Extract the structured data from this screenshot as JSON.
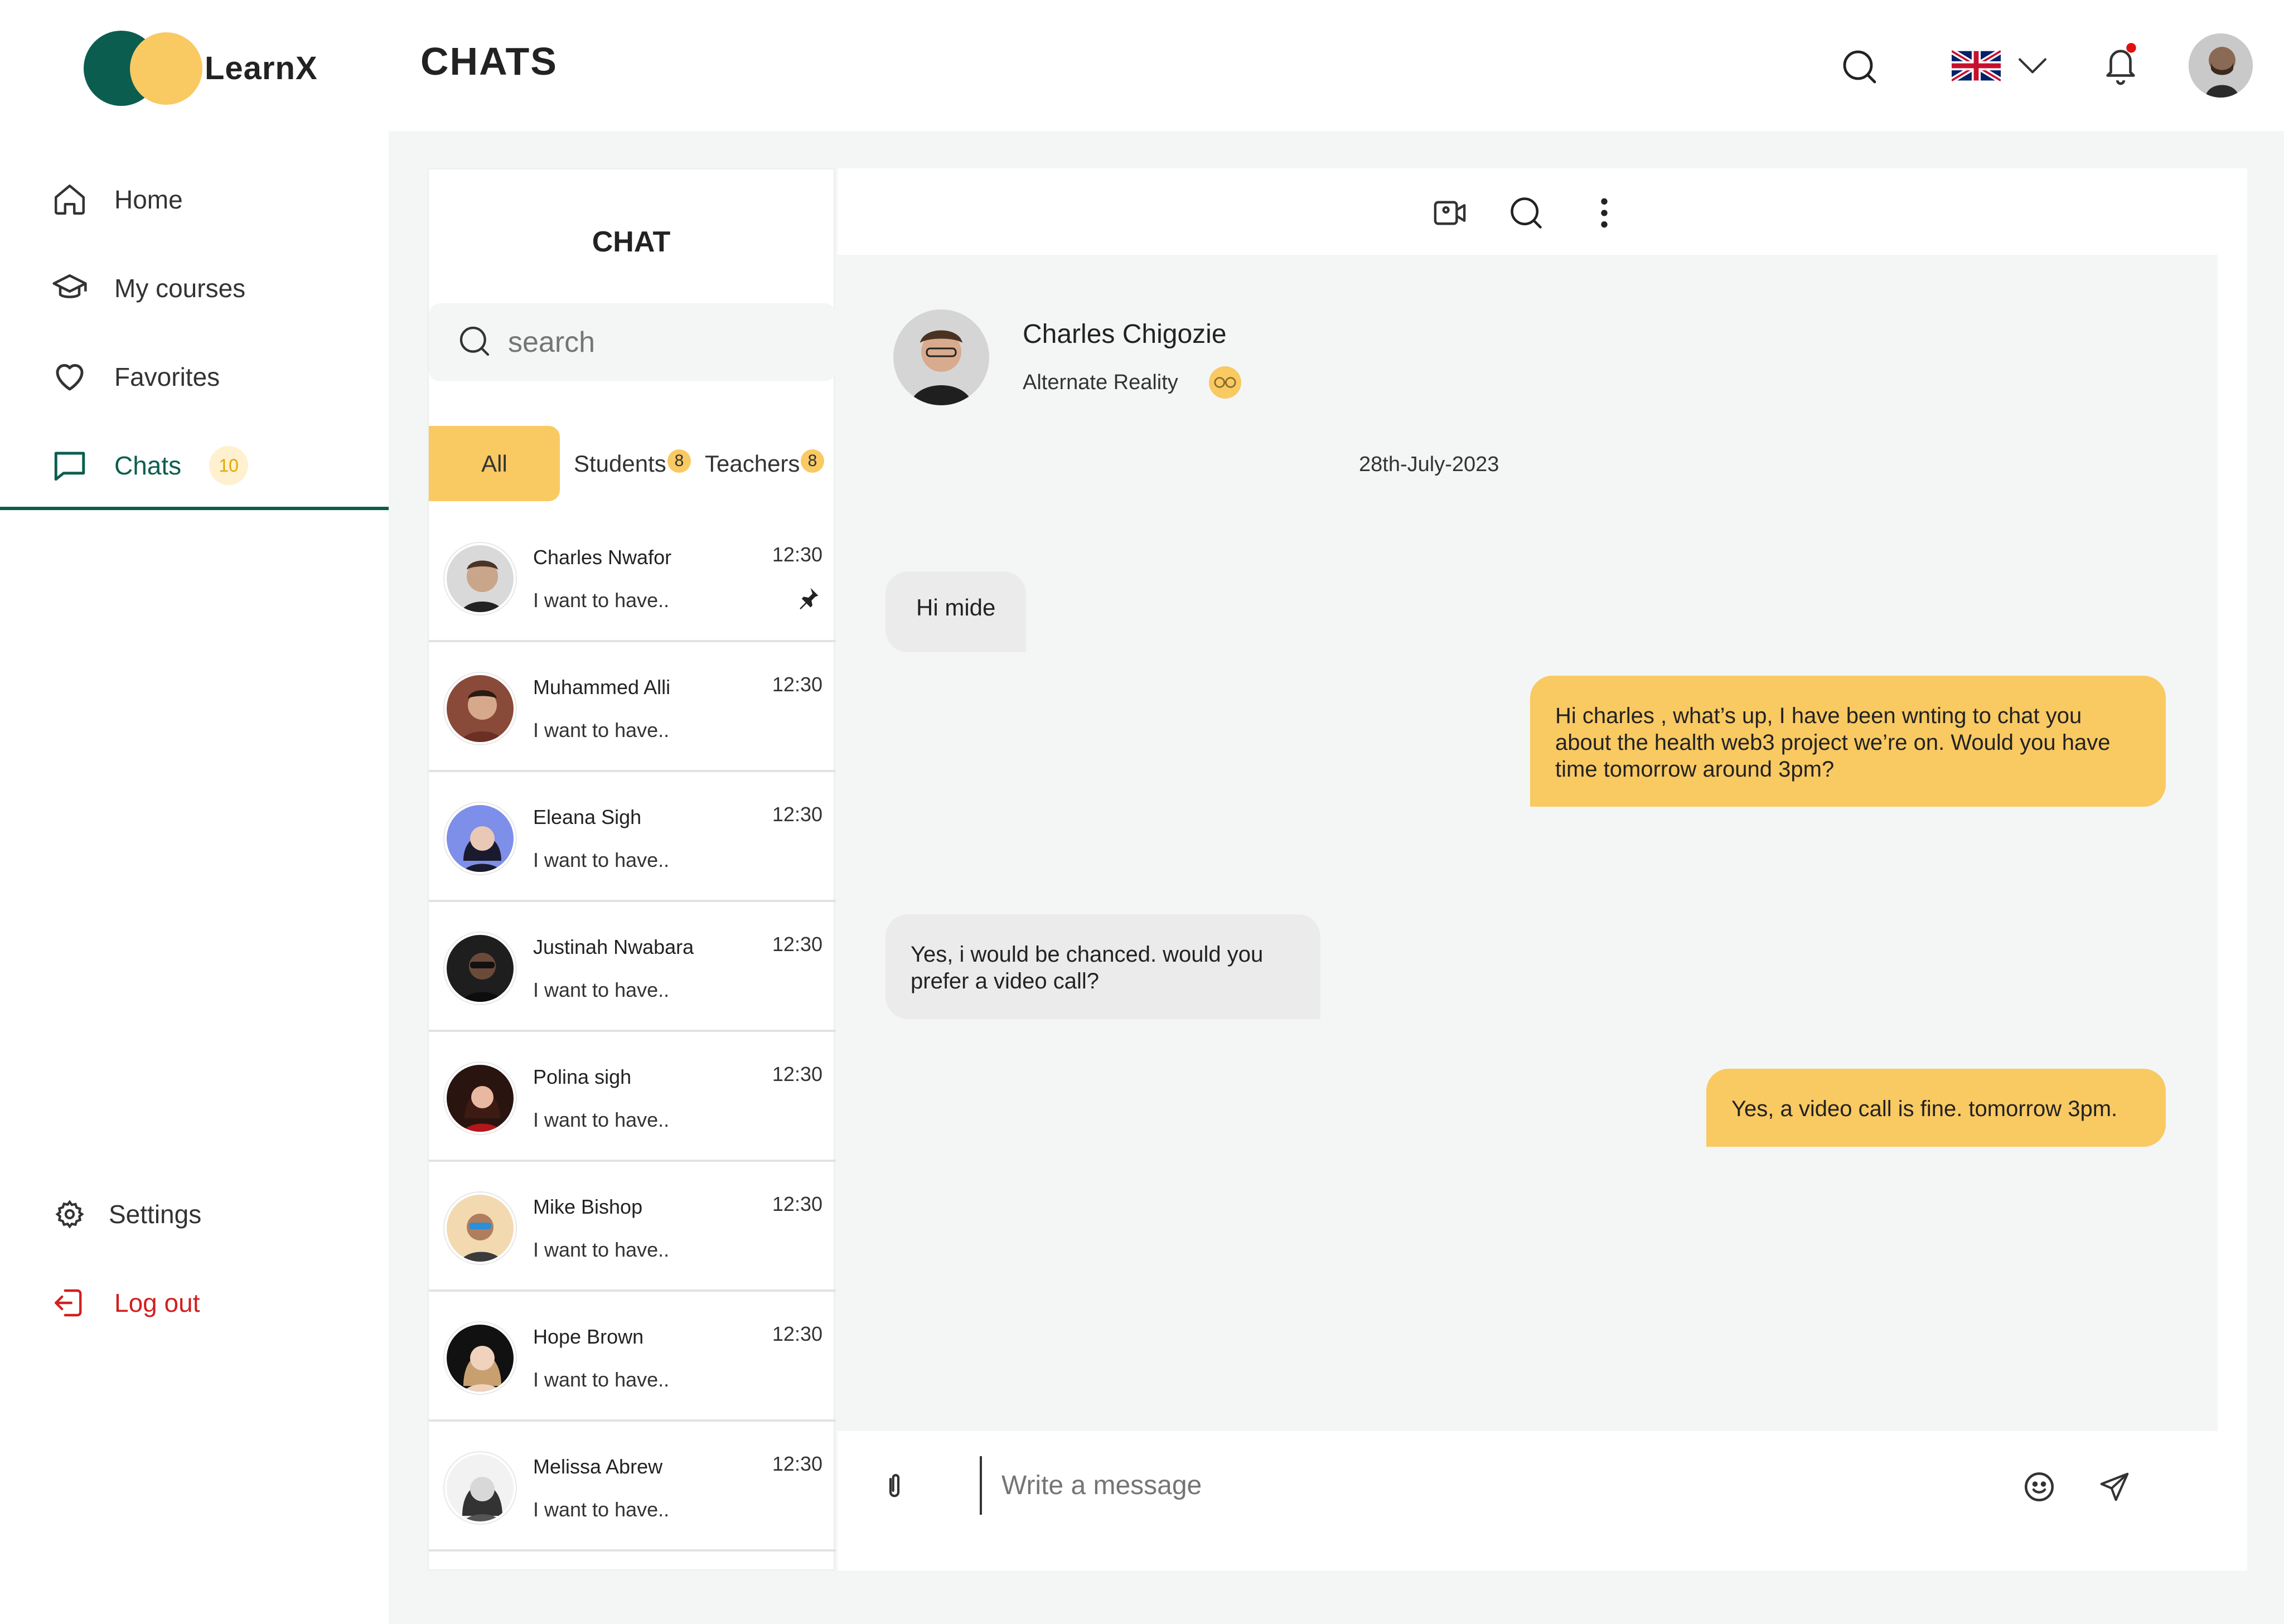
{
  "brand": {
    "name": "LearnX"
  },
  "header": {
    "title": "CHATS"
  },
  "sidebar": {
    "items": [
      {
        "label": "Home"
      },
      {
        "label": "My courses"
      },
      {
        "label": "Favorites"
      },
      {
        "label": "Chats",
        "badge": "10"
      }
    ],
    "settings": "Settings",
    "logout": "Log out"
  },
  "chat_panel": {
    "title": "CHAT",
    "search_placeholder": "search",
    "tabs": [
      {
        "label": "All"
      },
      {
        "label": "Students",
        "count": "8"
      },
      {
        "label": "Teachers",
        "count": "8"
      }
    ],
    "conversations": [
      {
        "name": "Charles Nwafor",
        "preview": "I want to have..",
        "time": "12:30",
        "pinned": true
      },
      {
        "name": "Muhammed Alli",
        "preview": "I want to have..",
        "time": "12:30"
      },
      {
        "name": "Eleana Sigh",
        "preview": "I want to have..",
        "time": "12:30"
      },
      {
        "name": "Justinah Nwabara",
        "preview": "I want to have..",
        "time": "12:30"
      },
      {
        "name": "Polina sigh",
        "preview": "I want to have..",
        "time": "12:30"
      },
      {
        "name": "Mike Bishop",
        "preview": "I want to have..",
        "time": "12:30"
      },
      {
        "name": "Hope Brown",
        "preview": "I want to have..",
        "time": "12:30"
      },
      {
        "name": "Melissa Abrew",
        "preview": "I want to have..",
        "time": "12:30"
      }
    ]
  },
  "conversation": {
    "contact_name": "Charles Chigozie",
    "contact_subtitle": "Alternate Reality",
    "date": "28th-July-2023",
    "messages": [
      {
        "from": "them",
        "text": "Hi mide"
      },
      {
        "from": "me",
        "text": "Hi charles , what’s up, I have been wnting to chat you about the health web3 project we’re on. Would you have time tomorrow around 3pm?"
      },
      {
        "from": "them",
        "text": "Yes, i would be chanced. would you prefer a video call?"
      },
      {
        "from": "me",
        "text": "Yes, a video call is fine. tomorrow 3pm."
      }
    ],
    "composer_placeholder": "Write a message"
  },
  "colors": {
    "brand_green": "#0b5e4f",
    "accent_yellow": "#f9c962",
    "danger": "#d21f1f",
    "notification_dot": "#e01010"
  }
}
